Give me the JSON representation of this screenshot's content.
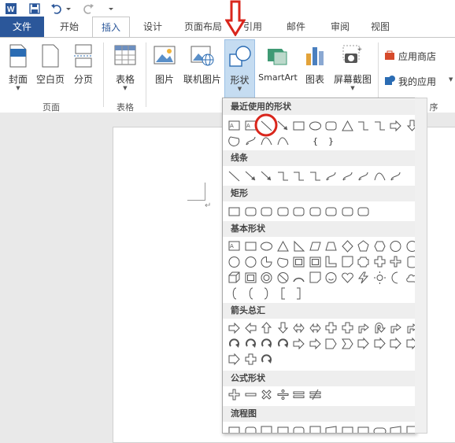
{
  "titlebar": {
    "icons": [
      "word-icon",
      "save-icon",
      "undo-icon",
      "undo-dropdown-icon",
      "redo-icon",
      "customize-icon"
    ]
  },
  "tabs": [
    {
      "label": "文件"
    },
    {
      "label": "开始"
    },
    {
      "label": "插入"
    },
    {
      "label": "设计"
    },
    {
      "label": "页面布局"
    },
    {
      "label": "引用"
    },
    {
      "label": "邮件"
    },
    {
      "label": "审阅"
    },
    {
      "label": "视图"
    }
  ],
  "ribbon": {
    "page_group": {
      "label": "页面",
      "buttons": [
        {
          "label": "封面"
        },
        {
          "label": "空白页"
        },
        {
          "label": "分页"
        }
      ]
    },
    "table_group": {
      "label": "表格",
      "button": "表格"
    },
    "illustrations": {
      "buttons": [
        {
          "label": "图片"
        },
        {
          "label": "联机图片"
        },
        {
          "label": "形状"
        },
        {
          "label": "SmartArt"
        },
        {
          "label": "图表"
        },
        {
          "label": "屏幕截图"
        }
      ]
    },
    "apps": {
      "store": "应用商店",
      "my_apps": "我的应用",
      "group_label_fragment": "序"
    }
  },
  "gallery": {
    "categories": [
      {
        "label": "最近使用的形状"
      },
      {
        "label": "线条"
      },
      {
        "label": "矩形"
      },
      {
        "label": "基本形状"
      },
      {
        "label": "箭头总汇"
      },
      {
        "label": "公式形状"
      },
      {
        "label": "流程图"
      }
    ],
    "brackets": [
      "{",
      "}"
    ]
  },
  "annotation": {
    "arrow_color": "#d9261c",
    "circle_color": "#d9261c"
  },
  "colors": {
    "accent": "#2b579a",
    "shape_stroke": "#555555"
  }
}
